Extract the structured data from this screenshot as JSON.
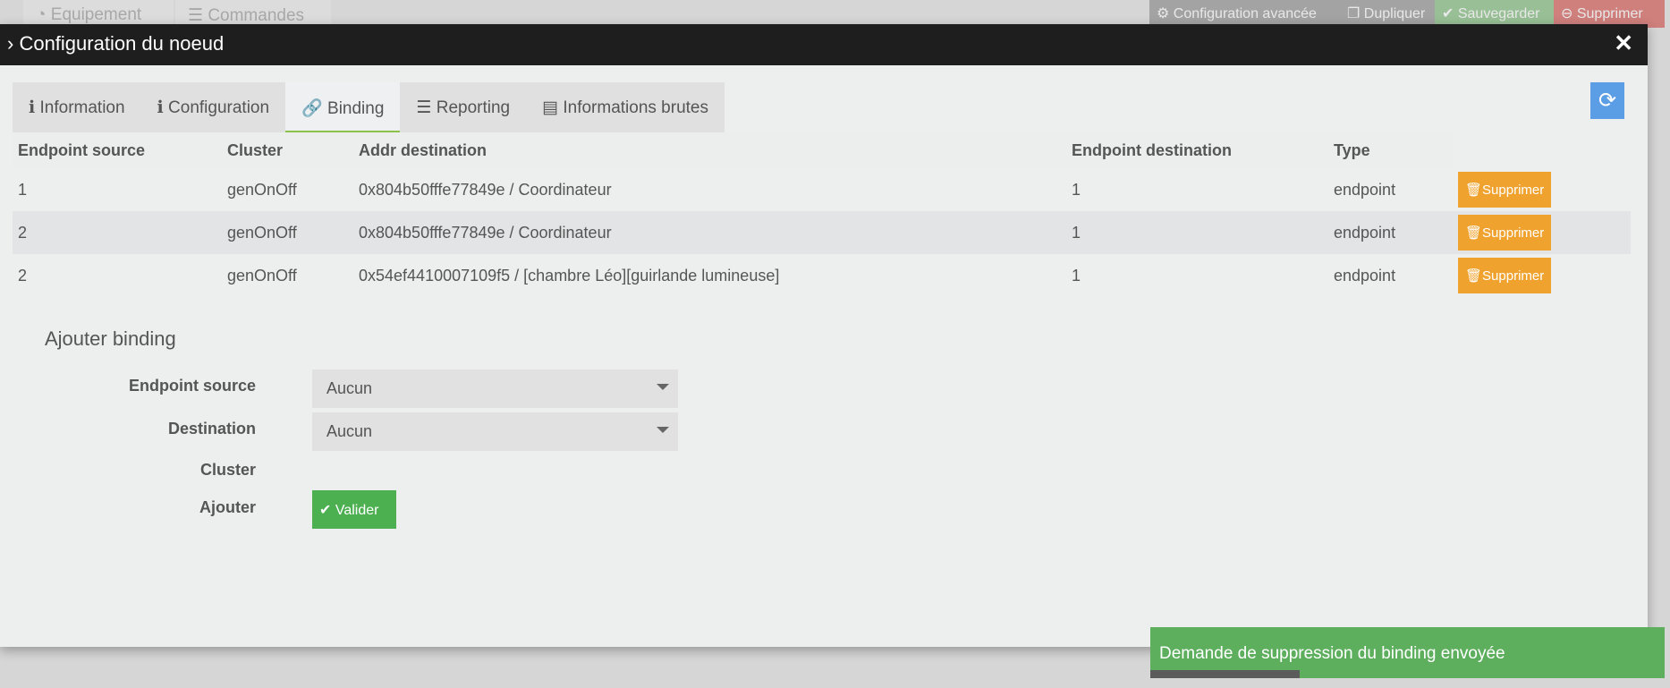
{
  "background_tabs": [
    "Equipement",
    "Commandes"
  ],
  "top_actions": {
    "advanced": "Configuration avancée",
    "duplicate": "Dupliquer",
    "save": "Sauvegarder",
    "delete": "Supprimer"
  },
  "modal": {
    "title": "Configuration du noeud"
  },
  "tabs": [
    {
      "label": "Information"
    },
    {
      "label": "Configuration"
    },
    {
      "label": "Binding",
      "active": true
    },
    {
      "label": "Reporting"
    },
    {
      "label": "Informations brutes"
    }
  ],
  "table": {
    "headers": [
      "Endpoint source",
      "Cluster",
      "Addr destination",
      "Endpoint destination",
      "Type"
    ],
    "rows": [
      {
        "src": "1",
        "cluster": "genOnOff",
        "addr": "0x804b50fffe77849e / Coordinateur",
        "dst": "1",
        "type": "endpoint",
        "action": "Supprimer"
      },
      {
        "src": "2",
        "cluster": "genOnOff",
        "addr": "0x804b50fffe77849e / Coordinateur",
        "dst": "1",
        "type": "endpoint",
        "action": "Supprimer"
      },
      {
        "src": "2",
        "cluster": "genOnOff",
        "addr": "0x54ef4410007109f5 / [chambre Léo][guirlande lumineuse]",
        "dst": "1",
        "type": "endpoint",
        "action": "Supprimer"
      }
    ]
  },
  "form": {
    "title": "Ajouter binding",
    "endpoint_label": "Endpoint source",
    "endpoint_value": "Aucun",
    "destination_label": "Destination",
    "destination_value": "Aucun",
    "cluster_label": "Cluster",
    "add_label": "Ajouter",
    "submit": "Valider"
  },
  "toast": {
    "message": "Demande de suppression du binding envoyée",
    "progress_percent": 29
  },
  "colors": {
    "accent": "#8bc34a",
    "warning": "#f0a22e",
    "success": "#4caf50",
    "info": "#5b9ee5"
  }
}
